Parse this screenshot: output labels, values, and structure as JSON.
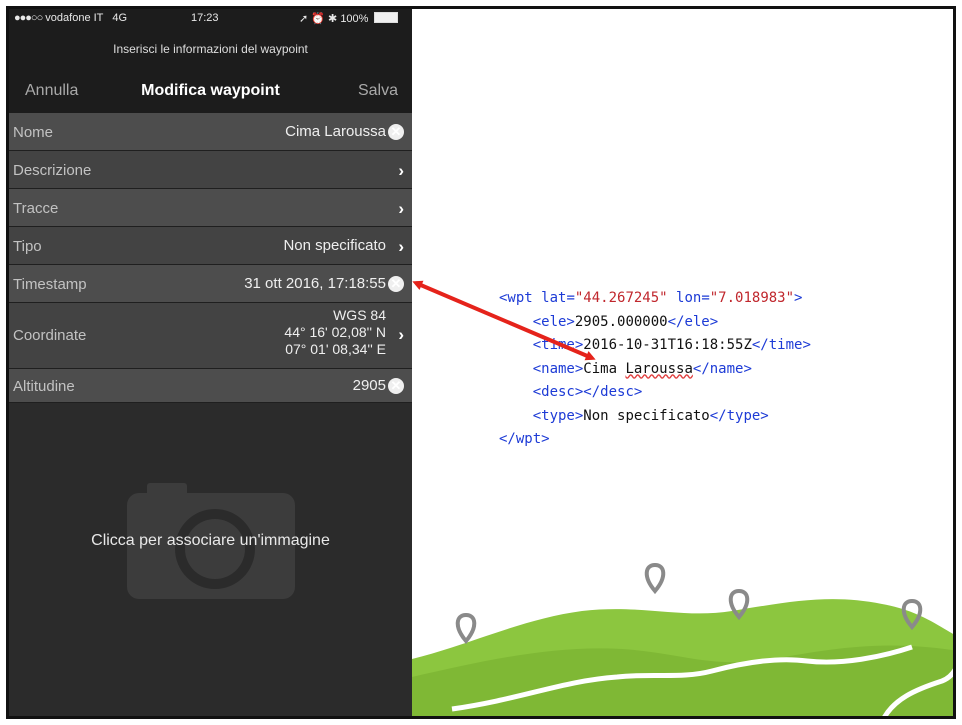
{
  "status_bar": {
    "signal": "●●●○○",
    "carrier": "vodafone IT",
    "network": "4G",
    "time": "17:23",
    "icons": "➚ ⏰ ✱",
    "battery": "100%"
  },
  "nav": {
    "prompt": "Inserisci le informazioni del waypoint",
    "cancel_label": "Annulla",
    "title": "Modifica waypoint",
    "save_label": "Salva"
  },
  "rows": [
    {
      "label": "Nome",
      "value": "Cima Laroussa",
      "icon": "clear-icon"
    },
    {
      "label": "Descrizione",
      "value": "",
      "icon": "chevron-right-icon"
    },
    {
      "label": "Tracce",
      "value": "",
      "icon": "chevron-right-icon"
    },
    {
      "label": "Tipo",
      "value": "Non specificato",
      "icon": "chevron-right-icon"
    },
    {
      "label": "Timestamp",
      "value": "31 ott 2016, 17:18:55",
      "icon": "clear-icon"
    },
    {
      "label": "Coordinate",
      "datum": "WGS 84",
      "lat": "44° 16' 02,08'' N",
      "lon": "07° 01' 08,34'' E",
      "icon": "chevron-right-icon"
    },
    {
      "label": "Altitudine",
      "value": "2905",
      "icon": "clear-icon"
    }
  ],
  "image_prompt": "Clicca per associare un'immagine",
  "xml": {
    "wpt_open": "<wpt",
    "lat_attr": "lat=",
    "lat_value": "\"44.267245\"",
    "lon_attr": "lon=",
    "lon_value": "\"7.018983\"",
    "wpt_close_bracket": ">",
    "ele_open": "<ele>",
    "ele_value": "2905.000000",
    "ele_close": "</ele>",
    "time_open": "<time>",
    "time_value": "2016-10-31T16:18:55Z",
    "time_close": "</time>",
    "name_open": "<name>",
    "name_value_1": "Cima ",
    "name_value_2": "Laroussa",
    "name_close": "</name>",
    "desc_open": "<desc>",
    "desc_close": "</desc>",
    "type_open": "<type>",
    "type_value": "Non specificato",
    "type_close": "</type>",
    "wpt_close": "</wpt>"
  },
  "colors": {
    "accent_arrow": "#e5231b",
    "xml_tag": "#1d3bd6",
    "xml_string": "#c0272d",
    "landscape_green": "#8cc63f"
  }
}
